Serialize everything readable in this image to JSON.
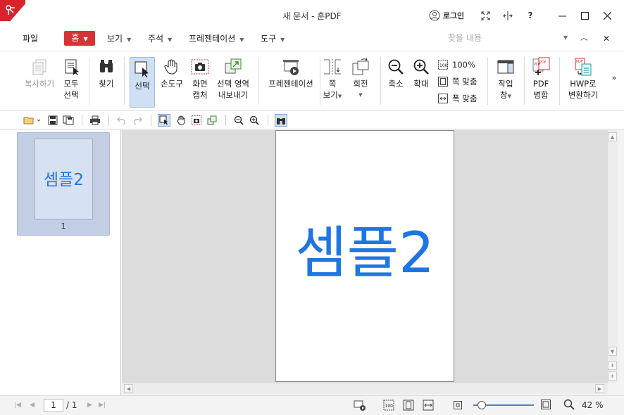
{
  "window": {
    "title": "새 문서 - 훈PDF",
    "login_label": "로그인",
    "help_label": "?"
  },
  "menu": {
    "file": "파일",
    "home": "홈",
    "view": "보기",
    "annotate": "주석",
    "presentation": "프레젠테이션",
    "tools": "도구",
    "search_placeholder": "찾을 내용"
  },
  "ribbon": {
    "copy": "복사하기",
    "select_all_1": "모두",
    "select_all_2": "선택",
    "find": "찾기",
    "select": "선택",
    "hand_tool": "손도구",
    "capture_1": "화면",
    "capture_2": "캡처",
    "export_1": "선택 영역",
    "export_2": "내보내기",
    "presentation": "프레젠테이션",
    "page_view_1": "쪽",
    "page_view_2": "보기",
    "rotate": "회전",
    "zoom_out": "축소",
    "zoom_in": "확대",
    "zoom_100": "100%",
    "fit_page": "쪽 맞춤",
    "fit_width": "폭 맞춤",
    "window_1": "작업",
    "window_2": "창",
    "merge_1": "PDF",
    "merge_2": "병합",
    "hwp_1": "HWP로",
    "hwp_2": "변환하기"
  },
  "document": {
    "thumbnail_text": "셈플2",
    "thumbnail_page": "1",
    "page_text": "셈플2"
  },
  "status": {
    "current_page": "1",
    "total_pages": "/ 1",
    "zoom": "42 %",
    "zoom_fraction": 0.42
  },
  "colors": {
    "accent": "#d53336",
    "selection": "#cfe0f5",
    "doc_text": "#1e76e3"
  }
}
